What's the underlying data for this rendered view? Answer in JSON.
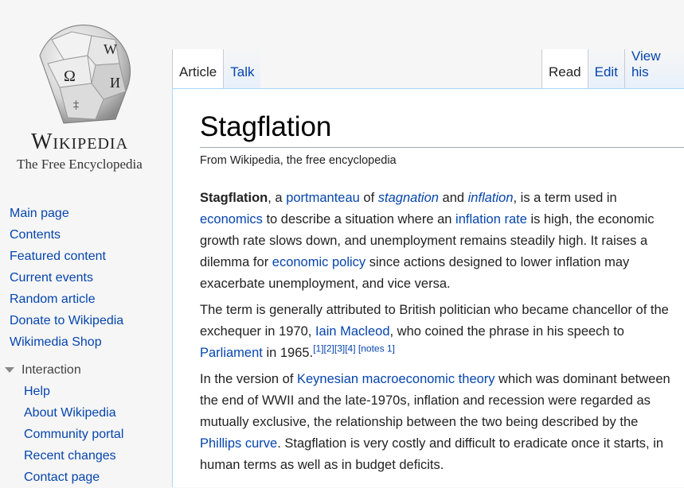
{
  "logo": {
    "wordmark": "Wikipedia",
    "tagline": "The Free Encyclopedia"
  },
  "sidebar": {
    "main": [
      "Main page",
      "Contents",
      "Featured content",
      "Current events",
      "Random article",
      "Donate to Wikipedia",
      "Wikimedia Shop"
    ],
    "interaction_heading": "Interaction",
    "interaction": [
      "Help",
      "About Wikipedia",
      "Community portal",
      "Recent changes",
      "Contact page"
    ]
  },
  "tabs": {
    "article": "Article",
    "talk": "Talk",
    "read": "Read",
    "edit": "Edit",
    "view_history": "View his"
  },
  "article": {
    "title": "Stagflation",
    "site_sub": "From Wikipedia, the free encyclopedia",
    "p1": {
      "bold": "Stagflation",
      "t1": ", a ",
      "l1": "portmanteau",
      "t2": " of ",
      "l2": "stagnation",
      "t3": " and ",
      "l3": "inflation",
      "t4": ", is a term used in ",
      "l4": "economics",
      "t5": " to describe a situation where an ",
      "l5": "inflation rate",
      "t6": " is high, the economic growth rate slows down, and unemployment remains steadily high. It raises a dilemma for ",
      "l6": "economic policy",
      "t7": " since actions designed to lower inflation may exacerbate unemployment, and vice versa."
    },
    "p2": {
      "t1": "The term is generally attributed to British politician who became chancellor of the exchequer in 1970, ",
      "l1": "Iain Macleod",
      "t2": ", who coined the phrase in his speech to ",
      "l2": "Parliament",
      "t3": " in 1965.",
      "refs": "[1][2][3][4]",
      "notes": " [notes 1]"
    },
    "p3": {
      "t1": "In the version of ",
      "l1": "Keynesian macroeconomic theory",
      "t2": " which was dominant between the end of WWII and the late-1970s, inflation and recession were regarded as mutually exclusive, the relationship between the two being described by the ",
      "l2": "Phillips curve",
      "t3": ". Stagflation is very costly and difficult to eradicate once it starts, in human terms as well as in budget deficits."
    }
  },
  "colors": {
    "link": "#0645ad",
    "content_border": "#a7d7f9",
    "background": "#f6f6f6"
  }
}
